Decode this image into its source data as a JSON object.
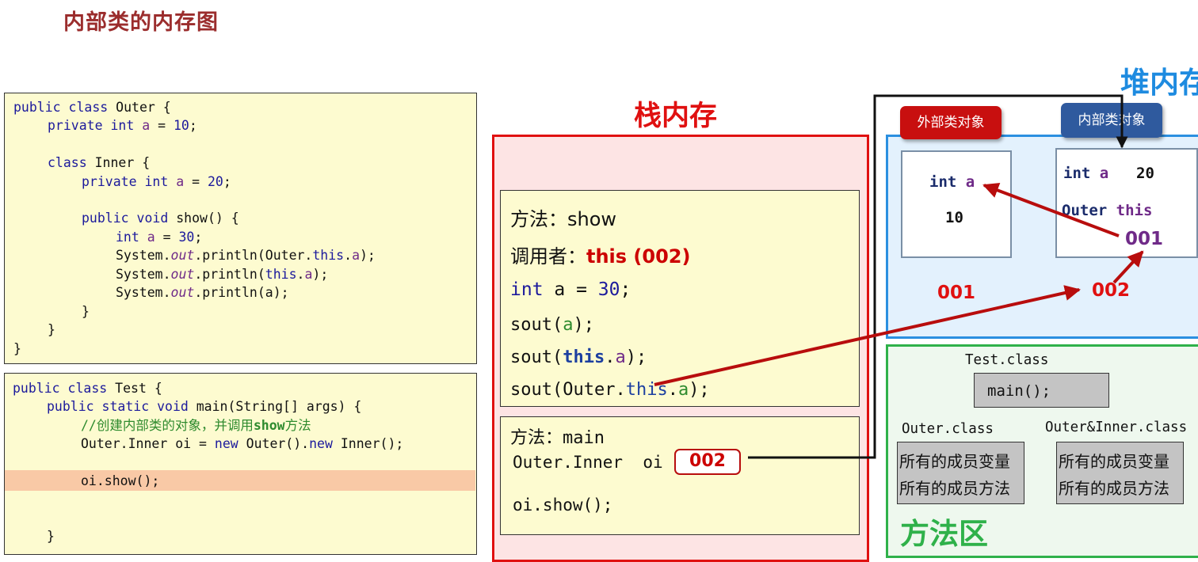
{
  "title": "内部类的内存图",
  "code_outer": {
    "l1": [
      "public class",
      " Outer {"
    ],
    "l2": [
      "private int",
      "a",
      " = ",
      "10",
      ";"
    ],
    "l3": [
      "class",
      " Inner {"
    ],
    "l4": [
      "private int",
      "a",
      " = ",
      "20",
      ";"
    ],
    "l5": [
      "public void",
      " show() {"
    ],
    "l6": [
      "int",
      "a",
      " = ",
      "30",
      ";"
    ],
    "l7": [
      "System.",
      "out",
      ".println(Outer.",
      "this",
      ".",
      "a",
      ");"
    ],
    "l8": [
      "System.",
      "out",
      ".println(",
      "this",
      ".",
      "a",
      ");"
    ],
    "l9": [
      "System.",
      "out",
      ".println(a);"
    ],
    "brace": "}"
  },
  "code_test": {
    "l1": [
      "public class",
      " Test {"
    ],
    "l2": [
      "public static void",
      " main(String[] args) {"
    ],
    "l3": [
      "//创建内部类的对象，并调用",
      "show",
      "方法"
    ],
    "l4": [
      "Outer.Inner oi = ",
      "new",
      " Outer().",
      "new",
      " Inner();"
    ],
    "l5": "oi.show();",
    "brace": "}"
  },
  "stack": {
    "title": "栈内存",
    "show_frame": {
      "method": "方法：show",
      "caller_label": "调用者：",
      "caller_value": "this (002)",
      "line1": [
        "int",
        " a = ",
        "30",
        ";"
      ],
      "line2": [
        "sout(",
        "a",
        ");"
      ],
      "line3": [
        "sout(",
        "this",
        ".",
        "a",
        ");"
      ],
      "line4": [
        "sout(Outer.",
        "this",
        ".",
        "a",
        ");"
      ]
    },
    "main_frame": {
      "method": "方法：main",
      "var_decl": "Outer.Inner  oi",
      "var_value": "002",
      "call": "oi.show();"
    }
  },
  "heap": {
    "title": "堆内存",
    "outer_obj": {
      "tag": "外部类对象",
      "field_type": "int",
      "field_name": "a",
      "field_value": "10",
      "address": "001"
    },
    "inner_obj": {
      "tag": "内部类对象",
      "field_type": "int",
      "field_name": "a",
      "field_value": "20",
      "ref_type": "Outer",
      "ref_name": "this",
      "ref_value": "001",
      "address": "002"
    }
  },
  "method_area": {
    "title": "方法区",
    "test_class": "Test.class",
    "test_method": "main();",
    "outer_class": "Outer.class",
    "inner_class": "Outer&Inner.class",
    "members_vars": "所有的成员变量",
    "members_methods": "所有的成员方法"
  },
  "colors": {
    "arrow": "#b80d0d",
    "stack_border": "#e01010",
    "heap_border": "#2b8fe0",
    "method_border": "#2fb14a",
    "outer_tag": "#c80f0f",
    "inner_tag": "#2f5a9e"
  }
}
